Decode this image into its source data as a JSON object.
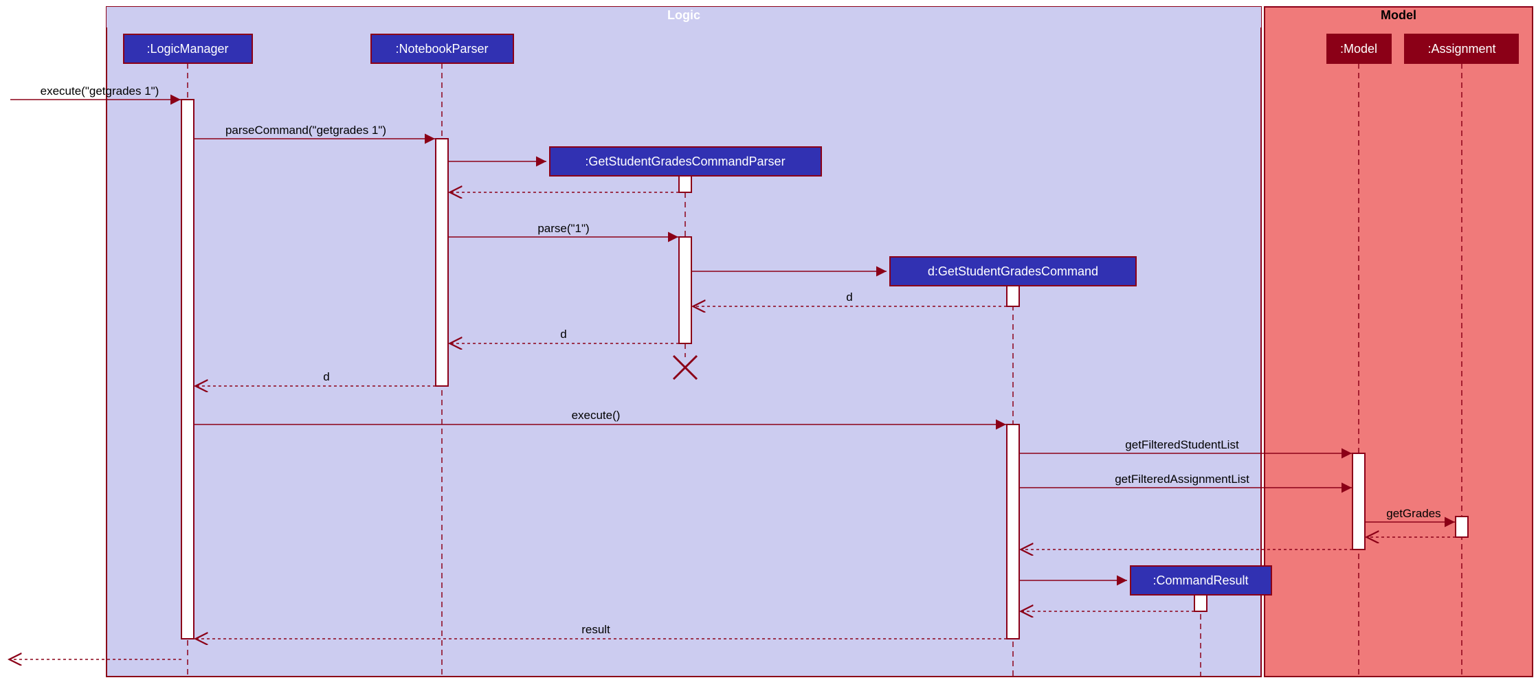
{
  "frames": {
    "logic_title": "Logic",
    "model_title": "Model"
  },
  "participants": {
    "logic_manager": ":LogicManager",
    "notebook_parser": ":NotebookParser",
    "grades_parser": ":GetStudentGradesCommandParser",
    "grades_command": "d:GetStudentGradesCommand",
    "command_result": ":CommandResult",
    "model": ":Model",
    "assignment": ":Assignment"
  },
  "messages": {
    "execute_in": "execute(\"getgrades 1\")",
    "parse_command": "parseCommand(\"getgrades 1\")",
    "parse": "parse(\"1\")",
    "d1": "d",
    "d2": "d",
    "d3": "d",
    "execute": "execute()",
    "get_students": "getFilteredStudentList",
    "get_assignments": "getFilteredAssignmentList",
    "get_grades": "getGrades",
    "result": "result"
  },
  "colors": {
    "logic_fill": "#CCCCF0",
    "model_fill": "#F07A7A",
    "box_fill": "#3131B2",
    "maroon": "#8B0017"
  }
}
